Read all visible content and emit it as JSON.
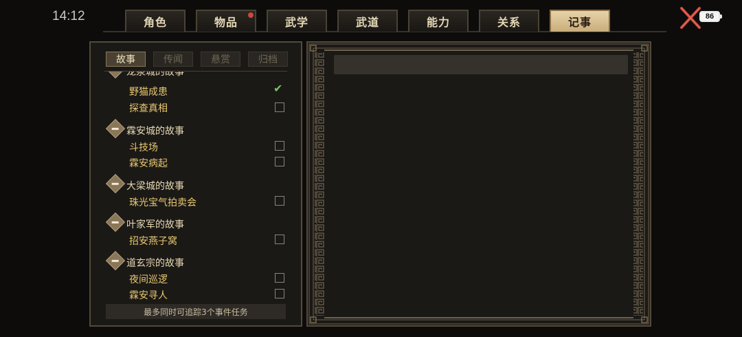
{
  "status": {
    "time": "14:12",
    "battery": "86"
  },
  "tabs": [
    {
      "label": "角色",
      "active": false,
      "dot": false
    },
    {
      "label": "物品",
      "active": false,
      "dot": true
    },
    {
      "label": "武学",
      "active": false,
      "dot": false
    },
    {
      "label": "武道",
      "active": false,
      "dot": false
    },
    {
      "label": "能力",
      "active": false,
      "dot": false
    },
    {
      "label": "关系",
      "active": false,
      "dot": false
    },
    {
      "label": "记事",
      "active": true,
      "dot": false
    }
  ],
  "subtabs": [
    "故事",
    "传闻",
    "悬赏",
    "归档"
  ],
  "quests": {
    "partial_group_title": "龙泉城的故事",
    "group0_items": [
      {
        "label": "野猫成患",
        "checked": true
      },
      {
        "label": "探查真相",
        "checked": false
      }
    ],
    "groups": [
      {
        "title": "霖安城的故事",
        "items": [
          {
            "label": "斗技场",
            "checked": false
          },
          {
            "label": "霖安病起",
            "checked": false
          }
        ]
      },
      {
        "title": "大梁城的故事",
        "items": [
          {
            "label": "珠光宝气拍卖会",
            "checked": false
          }
        ]
      },
      {
        "title": "叶家军的故事",
        "items": [
          {
            "label": "招安燕子窝",
            "checked": false
          }
        ]
      },
      {
        "title": "道玄宗的故事",
        "items": [
          {
            "label": "夜间巡逻",
            "checked": false
          },
          {
            "label": "霖安寻人",
            "checked": false
          }
        ]
      }
    ]
  },
  "footer": "最多同时可追踪3个事件任务",
  "colors": {
    "accent": "#e8c870",
    "active_tab": "#e7d3a8",
    "check": "#7ac26a",
    "close": "#c8483a"
  },
  "icons": {
    "close": "close-x-icon",
    "check": "checkmark-icon",
    "group": "collapse-minus-icon"
  }
}
